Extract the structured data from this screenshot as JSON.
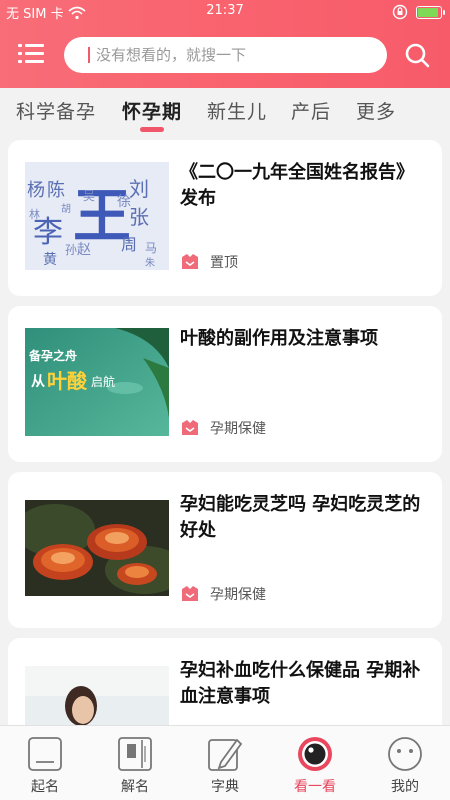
{
  "status_bar": {
    "carrier": "无 SIM 卡",
    "time": "21:37",
    "battery_percent": 95
  },
  "search": {
    "placeholder": "没有想看的，就搜一下"
  },
  "tabs": [
    {
      "label": "科学备孕",
      "active": false
    },
    {
      "label": "怀孕期",
      "active": true
    },
    {
      "label": "新生儿",
      "active": false
    },
    {
      "label": "产后",
      "active": false
    },
    {
      "label": "更多",
      "active": false
    }
  ],
  "articles": [
    {
      "title": "《二〇一九年全国姓名报告》发布",
      "tag": "置顶",
      "thumb_text": [
        "杨",
        "陈",
        "王",
        "刘",
        "李",
        "张",
        "吴",
        "徐",
        "赵",
        "孙",
        "周",
        "马",
        "黄",
        "胡",
        "朱",
        "林"
      ]
    },
    {
      "title": "叶酸的副作用及注意事项",
      "tag": "孕期保健",
      "thumb_text": [
        "备孕之舟",
        "从",
        "叶酸",
        "启航"
      ]
    },
    {
      "title": "孕妇能吃灵芝吗 孕妇吃灵芝的好处",
      "tag": "孕期保健",
      "thumb_text": []
    },
    {
      "title": "孕妇补血吃什么保健品 孕期补血注意事项",
      "tag": "",
      "thumb_text": []
    }
  ],
  "bottom_nav": [
    {
      "label": "起名",
      "icon": "naming-icon",
      "active": false
    },
    {
      "label": "解名",
      "icon": "book-icon",
      "active": false
    },
    {
      "label": "字典",
      "icon": "dictionary-icon",
      "active": false
    },
    {
      "label": "看一看",
      "icon": "eye-icon",
      "active": true
    },
    {
      "label": "我的",
      "icon": "profile-face-icon",
      "active": false
    }
  ],
  "colors": {
    "brand": "#f9636e",
    "accent": "#e8475e"
  }
}
